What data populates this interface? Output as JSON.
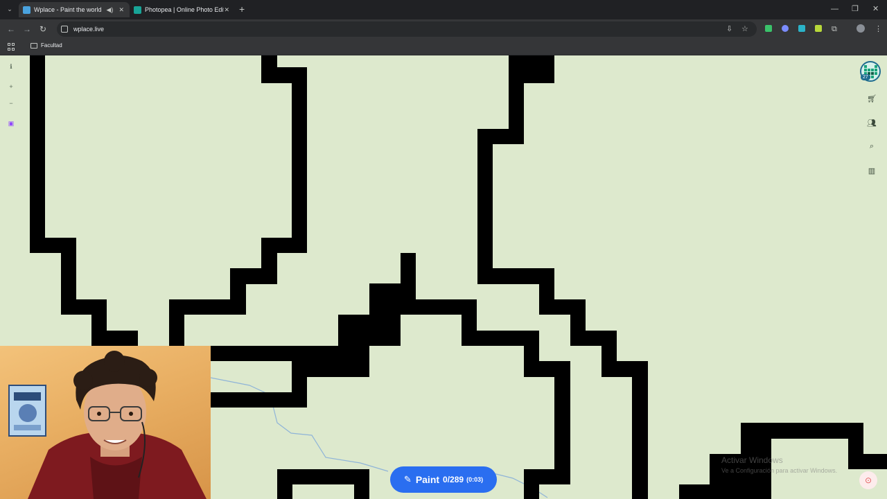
{
  "browser": {
    "tabs": [
      {
        "title": "Wplace - Paint the world",
        "active": true
      },
      {
        "title": "Photopea | Online Photo Editor",
        "active": false
      }
    ],
    "url": "wplace.live",
    "bookmarks": [
      {
        "label": "Facultad"
      }
    ]
  },
  "paint_button": {
    "label": "Paint",
    "charges": "0/289",
    "timer": "(0:03)"
  },
  "profile": {
    "level": "27"
  },
  "watermark": {
    "title": "Activar Windows",
    "subtitle": "Ve a Configuración para activar Windows."
  },
  "colors": {
    "canvas_bg": "#dde9cd",
    "pixel": "#000000",
    "paint_button": "#2a6ef0",
    "river": "#8fb4d8"
  },
  "icons": {
    "left_toolbar": [
      "info-icon",
      "zoom-in-icon",
      "zoom-out-icon",
      "twitch-icon"
    ],
    "right_toolbar": [
      "cart-icon",
      "users-icon",
      "search-location-icon",
      "leaderboard-icon"
    ]
  }
}
